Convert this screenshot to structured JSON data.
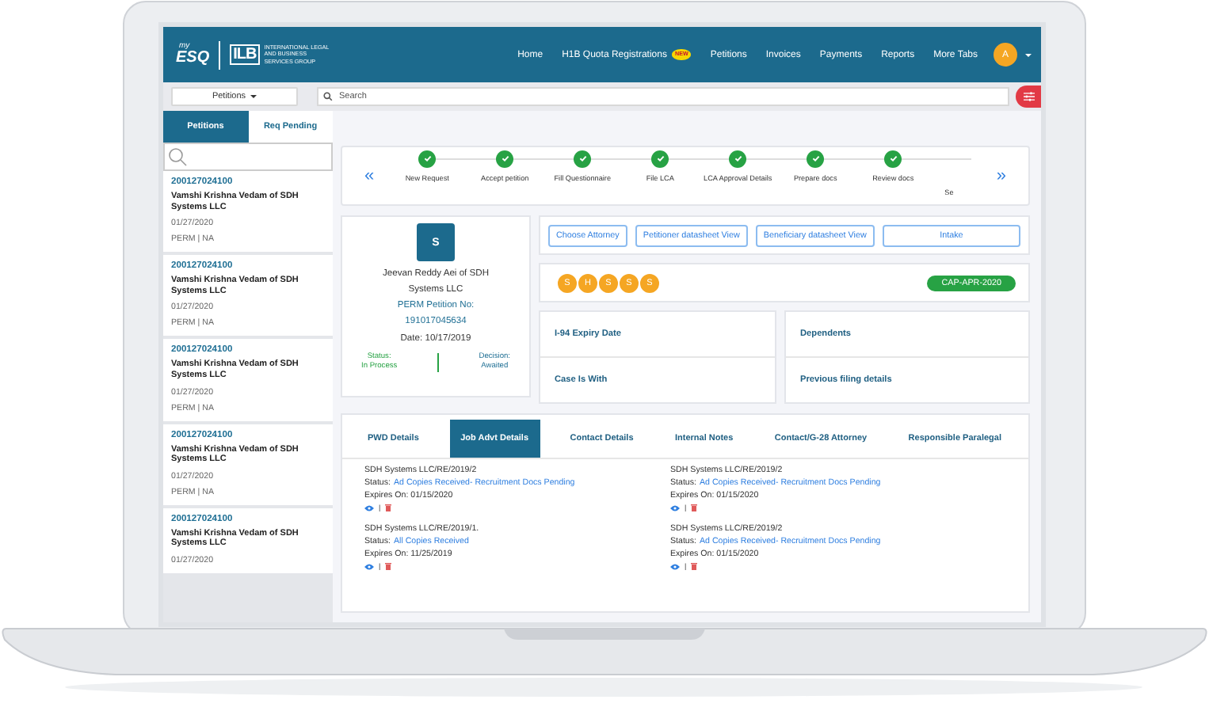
{
  "header": {
    "logo": {
      "small": "my",
      "large": "ESQ"
    },
    "org_logo": "ILB",
    "org_name": "INTERNATIONAL LEGAL AND BUSINESS SERVICES GROUP",
    "nav": [
      {
        "label": "Home"
      },
      {
        "label": "H1B Quota Registrations",
        "badge": "NEW"
      },
      {
        "label": "Petitions"
      },
      {
        "label": "Invoices"
      },
      {
        "label": "Payments"
      },
      {
        "label": "Reports"
      },
      {
        "label": "More Tabs"
      }
    ],
    "avatar": "A"
  },
  "toolbar": {
    "dropdown": "Petitions",
    "search": {
      "placeholder": "Search"
    }
  },
  "sidebar": {
    "tabs": [
      {
        "label": "Petitions",
        "selected": true
      },
      {
        "label": "Req Pending",
        "selected": false
      }
    ],
    "items": [
      {
        "number": "200127024100",
        "name": "Vamshi Krishna Vedam of SDH Systems LLC",
        "date": "01/27/2020",
        "type": "PERM | NA"
      },
      {
        "number": "200127024100",
        "name": "Vamshi Krishna Vedam of SDH Systems LLC",
        "date": "01/27/2020",
        "type": "PERM | NA"
      },
      {
        "number": "200127024100",
        "name": "Vamshi Krishna Vedam of SDH Systems LLC",
        "date": "01/27/2020",
        "type": "PERM | NA"
      },
      {
        "number": "200127024100",
        "name": "Vamshi Krishna Vedam of SDH Systems LLC",
        "date": "01/27/2020",
        "type": "PERM | NA"
      },
      {
        "number": "200127024100",
        "name": "Vamshi Krishna Vedam of SDH Systems LLC",
        "date": "01/27/2020"
      }
    ]
  },
  "stepper": {
    "prev": "«",
    "next": "»",
    "steps": [
      {
        "label": "New Request",
        "done": true
      },
      {
        "label": "Accept petition",
        "done": true
      },
      {
        "label": "Fill Questionnaire",
        "done": true
      },
      {
        "label": "File LCA",
        "done": true
      },
      {
        "label": "LCA Approval Details",
        "done": true
      },
      {
        "label": "Prepare docs",
        "done": true
      },
      {
        "label": "Review docs",
        "done": true
      }
    ],
    "cut_label": "Se"
  },
  "profile": {
    "initial": "S",
    "name": "Jeevan Reddy Aei of SDH Systems LLC",
    "petition_label": "PERM Petition No:",
    "petition_number": "191017045634",
    "date": "Date: 10/17/2019",
    "status_label": "Status:",
    "status": "In Process",
    "decision_label": "Decision:",
    "decision": "Awaited"
  },
  "actions": [
    "Choose Attorney",
    "Petitioner datasheet View",
    "Beneficiary datasheet View",
    "Intake"
  ],
  "badges": {
    "letters": [
      "S",
      "H",
      "S",
      "S",
      "S"
    ],
    "tag": "CAP-APR-2020"
  },
  "info": [
    {
      "labels": [
        "I-94 Expiry Date",
        "Case Is With"
      ]
    },
    {
      "labels": [
        "Dependents",
        "Previous filing details"
      ]
    }
  ],
  "details": {
    "tabs": [
      {
        "label": "PWD Details",
        "selected": false
      },
      {
        "label": "Job Advt Details",
        "selected": true
      },
      {
        "label": "Contact Details",
        "selected": false
      },
      {
        "label": "Internal Notes",
        "selected": false
      },
      {
        "label": "Contact/G-28 Attorney",
        "selected": false
      },
      {
        "label": "Responsible Paralegal",
        "selected": false
      }
    ],
    "entries": [
      {
        "title": "SDH Systems LLC/RE/2019/2",
        "status_label": "Status:",
        "status": "Ad Copies Received- Recruitment Docs Pending",
        "expires": "Expires On: 01/15/2020",
        "separator": "|"
      },
      {
        "title": "SDH Systems LLC/RE/2019/2",
        "status_label": "Status:",
        "status": "Ad Copies Received- Recruitment Docs Pending",
        "expires": "Expires On: 01/15/2020",
        "separator": "|"
      },
      {
        "title": "SDH Systems LLC/RE/2019/1.",
        "status_label": "Status:",
        "status": "All Copies Received",
        "expires": "Expires On: 11/25/2019",
        "separator": "|"
      },
      {
        "title": "SDH Systems LLC/RE/2019/2",
        "status_label": "Status:",
        "status": "Ad Copies Received- Recruitment Docs Pending",
        "expires": "Expires On: 01/15/2020",
        "separator": "|"
      }
    ]
  }
}
